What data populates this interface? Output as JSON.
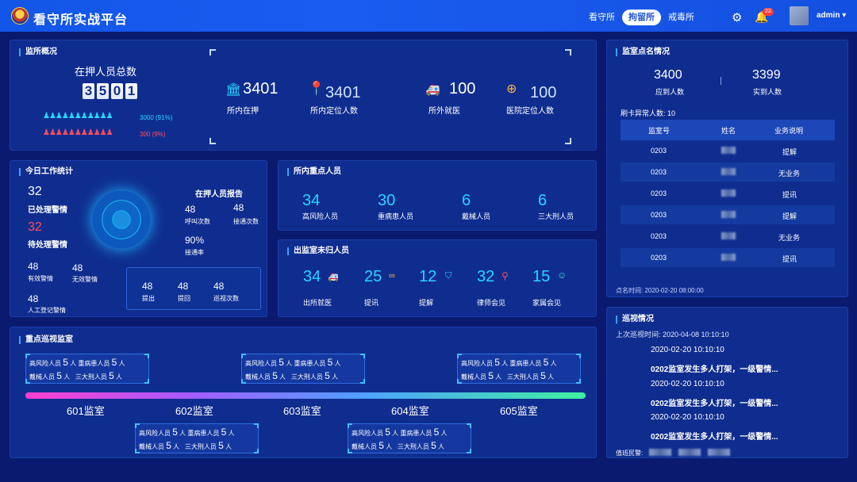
{
  "header": {
    "title": "看守所实战平台",
    "tabs": [
      "看守所",
      "拘留所",
      "戒毒所"
    ],
    "active_tab": 1,
    "bell_count": "23",
    "user": "admin ▾"
  },
  "overview": {
    "title": "监所概况",
    "total_label": "在押人员总数",
    "digits": [
      "3",
      "5",
      "0",
      "1"
    ],
    "male": {
      "text": "3000 (91%)",
      "fraction": 0.91
    },
    "female": {
      "text": "300 (9%)",
      "fraction": 0.09
    },
    "stats": [
      {
        "value": "3401",
        "label": "所内在押",
        "icon": "building-icon"
      },
      {
        "value": "3401",
        "label": "所内定位人数",
        "icon": "location-pin-icon"
      },
      {
        "value": "100",
        "label": "所外就医",
        "icon": "ambulance-icon"
      },
      {
        "value": "100",
        "label": "医院定位人数",
        "icon": "hospital-location-icon"
      }
    ]
  },
  "rollcall": {
    "title": "监室点名情况",
    "expected": "3400",
    "expected_label": "应到人数",
    "actual": "3399",
    "actual_label": "实到人数",
    "abnormal": "刷卡异常人数:  10",
    "columns": [
      "监室号",
      "姓名",
      "业务说明"
    ],
    "rows": [
      {
        "room": "0203",
        "desc": "提解"
      },
      {
        "room": "0203",
        "desc": "无业务"
      },
      {
        "room": "0203",
        "desc": "提讯"
      },
      {
        "room": "0203",
        "desc": "提解"
      },
      {
        "room": "0203",
        "desc": "无业务"
      },
      {
        "room": "0203",
        "desc": "提讯"
      }
    ],
    "time": "点名时间:  2020-02-20 08:00:00"
  },
  "work": {
    "title": "今日工作统计",
    "handled": "32",
    "handled_label": "已处理警情",
    "pending": "32",
    "pending_label": "待处理警情",
    "valid": "48",
    "valid_label": "有效警情",
    "invalid": "48",
    "invalid_label": "无效警情",
    "manual": "48",
    "manual_label": "人工登记警情",
    "report_title": "在押人员报告",
    "call": "48",
    "call_label": "呼叫次数",
    "answer": "48",
    "answer_label": "接通次数",
    "rate": "90%",
    "rate_label": "接通率",
    "bottom": [
      {
        "v": "48",
        "l": "提出"
      },
      {
        "v": "48",
        "l": "提回"
      },
      {
        "v": "48",
        "l": "巡视次数"
      }
    ]
  },
  "key": {
    "title": "所内重点人员",
    "items": [
      {
        "v": "34",
        "l": "高风险人员"
      },
      {
        "v": "30",
        "l": "重病患人员"
      },
      {
        "v": "6",
        "l": "戴械人员"
      },
      {
        "v": "6",
        "l": "三大刑人员"
      }
    ]
  },
  "away": {
    "title": "出监室未归人员",
    "items": [
      {
        "v": "34",
        "l": "出所就医",
        "icon": "ambulance-icon"
      },
      {
        "v": "25",
        "l": "提讯",
        "icon": "handcuffs-icon"
      },
      {
        "v": "12",
        "l": "提解",
        "icon": "shield-icon"
      },
      {
        "v": "32",
        "l": "律师会见",
        "icon": "tie-icon"
      },
      {
        "v": "15",
        "l": "家属会见",
        "icon": "family-icon"
      }
    ]
  },
  "patrol_rooms": {
    "title": "重点巡视监室",
    "rooms": [
      "601监室",
      "602监室",
      "603监室",
      "604监室",
      "605监室"
    ],
    "box": {
      "a": "高风险人员",
      "b": "重病患人员",
      "c": "戴械人员",
      "d": "三大刑人员",
      "n": "5",
      "unit": "人"
    }
  },
  "patrol": {
    "title": "巡视情况",
    "last": "上次巡视时间:  2020-04-08 10:10:10",
    "entries": [
      "2020-02-20 10:10:10",
      "0202监室发生多人打架，一级警情...",
      "2020-02-20 10:10:10",
      "0202监室发生多人打架，一级警情...",
      "2020-02-20 10:10:10",
      "0202监室发生多人打架，一级警情..."
    ],
    "duty": "值班民警:"
  }
}
